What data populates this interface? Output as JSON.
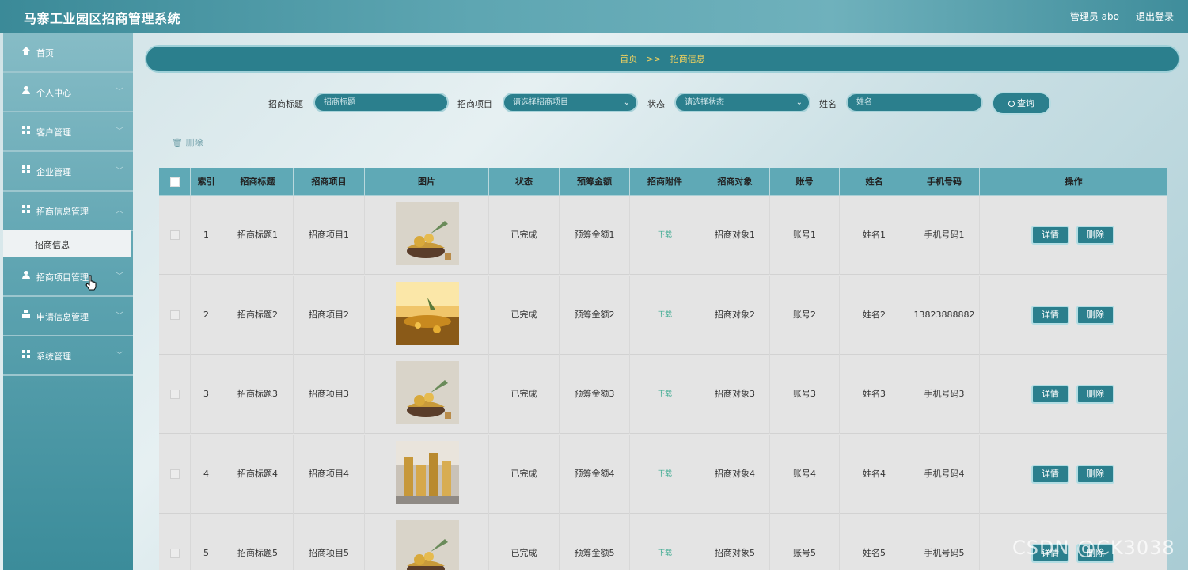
{
  "header": {
    "app_title": "马寨工业园区招商管理系统",
    "user_label": "管理员 abo",
    "logout_label": "退出登录"
  },
  "sidebar": {
    "items": [
      {
        "label": "首页",
        "icon": "home-icon"
      },
      {
        "label": "个人中心",
        "icon": "user-icon"
      },
      {
        "label": "客户管理",
        "icon": "grid-icon"
      },
      {
        "label": "企业管理",
        "icon": "grid-icon"
      },
      {
        "label": "招商信息管理",
        "icon": "grid-icon"
      },
      {
        "label": "招商项目管理",
        "icon": "user-icon"
      },
      {
        "label": "申请信息管理",
        "icon": "printer-icon"
      },
      {
        "label": "系统管理",
        "icon": "grid-icon"
      }
    ],
    "active_sub": "招商信息"
  },
  "breadcrumb": {
    "home": "首页",
    "separator": ">>",
    "current": "招商信息"
  },
  "search": {
    "title_label": "招商标题",
    "title_placeholder": "招商标题",
    "project_label": "招商项目",
    "project_placeholder": "请选择招商项目",
    "status_label": "状态",
    "status_placeholder": "请选择状态",
    "name_label": "姓名",
    "name_placeholder": "姓名",
    "query_button": "查询"
  },
  "toolbar": {
    "delete_label": "删除"
  },
  "table": {
    "columns": [
      "索引",
      "招商标题",
      "招商项目",
      "图片",
      "状态",
      "预筹金额",
      "招商附件",
      "招商对象",
      "账号",
      "姓名",
      "手机号码",
      "操作"
    ],
    "rows": [
      {
        "index": "1",
        "title": "招商标题1",
        "project": "招商项目1",
        "image": "gold-bowl",
        "status": "已完成",
        "amount": "预筹金额1",
        "attachment": "下载",
        "target": "招商对象1",
        "account": "账号1",
        "name": "姓名1",
        "phone": "手机号码1"
      },
      {
        "index": "2",
        "title": "招商标题2",
        "project": "招商项目2",
        "image": "gold-field",
        "status": "已完成",
        "amount": "预筹金额2",
        "attachment": "下载",
        "target": "招商对象2",
        "account": "账号2",
        "name": "姓名2",
        "phone": "13823888882"
      },
      {
        "index": "3",
        "title": "招商标题3",
        "project": "招商项目3",
        "image": "gold-bowl",
        "status": "已完成",
        "amount": "预筹金额3",
        "attachment": "下载",
        "target": "招商对象3",
        "account": "账号3",
        "name": "姓名3",
        "phone": "手机号码3"
      },
      {
        "index": "4",
        "title": "招商标题4",
        "project": "招商项目4",
        "image": "coin-stacks",
        "status": "已完成",
        "amount": "预筹金额4",
        "attachment": "下载",
        "target": "招商对象4",
        "account": "账号4",
        "name": "姓名4",
        "phone": "手机号码4"
      },
      {
        "index": "5",
        "title": "招商标题5",
        "project": "招商项目5",
        "image": "gold-bowl",
        "status": "已完成",
        "amount": "预筹金额5",
        "attachment": "下载",
        "target": "招商对象5",
        "account": "账号5",
        "name": "姓名5",
        "phone": "手机号码5"
      }
    ],
    "detail_label": "详情",
    "delete_label": "删除"
  },
  "watermark": "CSDN @CK3038",
  "colors": {
    "primary": "#2b7f8d",
    "header_bg": "#5fa9b6",
    "crumb_text": "#f4d35e"
  }
}
